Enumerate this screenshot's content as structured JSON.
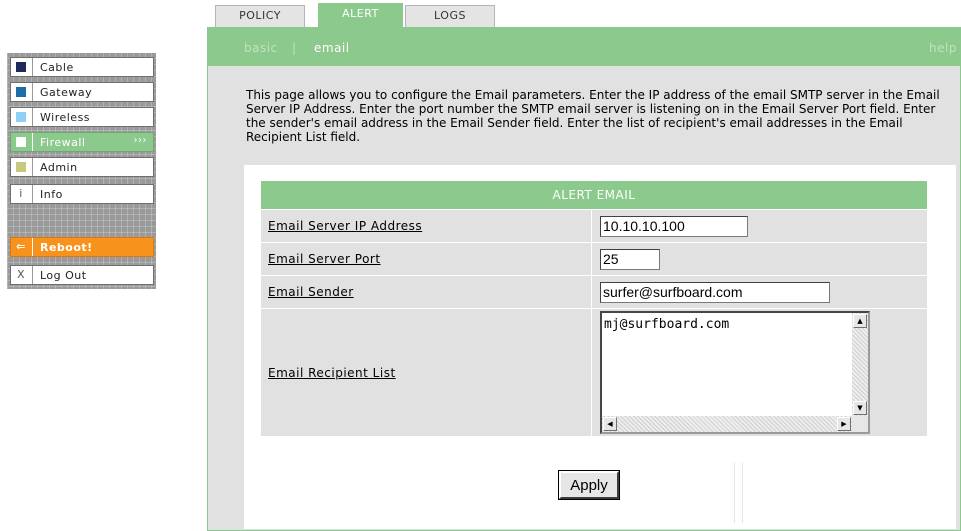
{
  "nav": {
    "items": [
      {
        "label": "Cable",
        "color": "#1f2a5c"
      },
      {
        "label": "Gateway",
        "color": "#1a6fa8"
      },
      {
        "label": "Wireless",
        "color": "#8fd0f5"
      },
      {
        "label": "Firewall",
        "color": "#ffffff",
        "active": true,
        "arrows": "›››"
      },
      {
        "label": "Admin",
        "color": "#c8c87f"
      },
      {
        "label": "Info",
        "glyph": "i"
      }
    ],
    "reboot": {
      "label": "Reboot!",
      "glyph": "⇐"
    },
    "logout": {
      "label": "Log Out",
      "glyph": "X"
    }
  },
  "tabs": [
    {
      "label": "POLICY"
    },
    {
      "label": "ALERT",
      "active": true
    },
    {
      "label": "LOGS"
    }
  ],
  "subnav": {
    "basic": "basic",
    "separator": "|",
    "email": "email",
    "help": "help"
  },
  "description": "This page allows you to configure the Email parameters. Enter the IP address of the email SMTP server in the Email Server IP Address. Enter the port number the SMTP email server is listening on in the Email Server Port field. Enter the sender's email address in the Email Sender field. Enter the list of recipient's email addresses in the Email Recipient List field.",
  "form": {
    "title": "ALERT EMAIL",
    "server_ip": {
      "label": "Email Server IP Address",
      "value": "10.10.10.100"
    },
    "server_port": {
      "label": "Email Server Port",
      "value": "25"
    },
    "sender": {
      "label": "Email Sender",
      "value": "surfer@surfboard.com"
    },
    "recipients": {
      "label": "Email Recipient List",
      "value": "mj@surfboard.com"
    },
    "apply": "Apply"
  },
  "colors": {
    "accent_green": "#8cc98c",
    "panel_gray": "#e1e1e1",
    "reboot_orange": "#f7931d"
  }
}
